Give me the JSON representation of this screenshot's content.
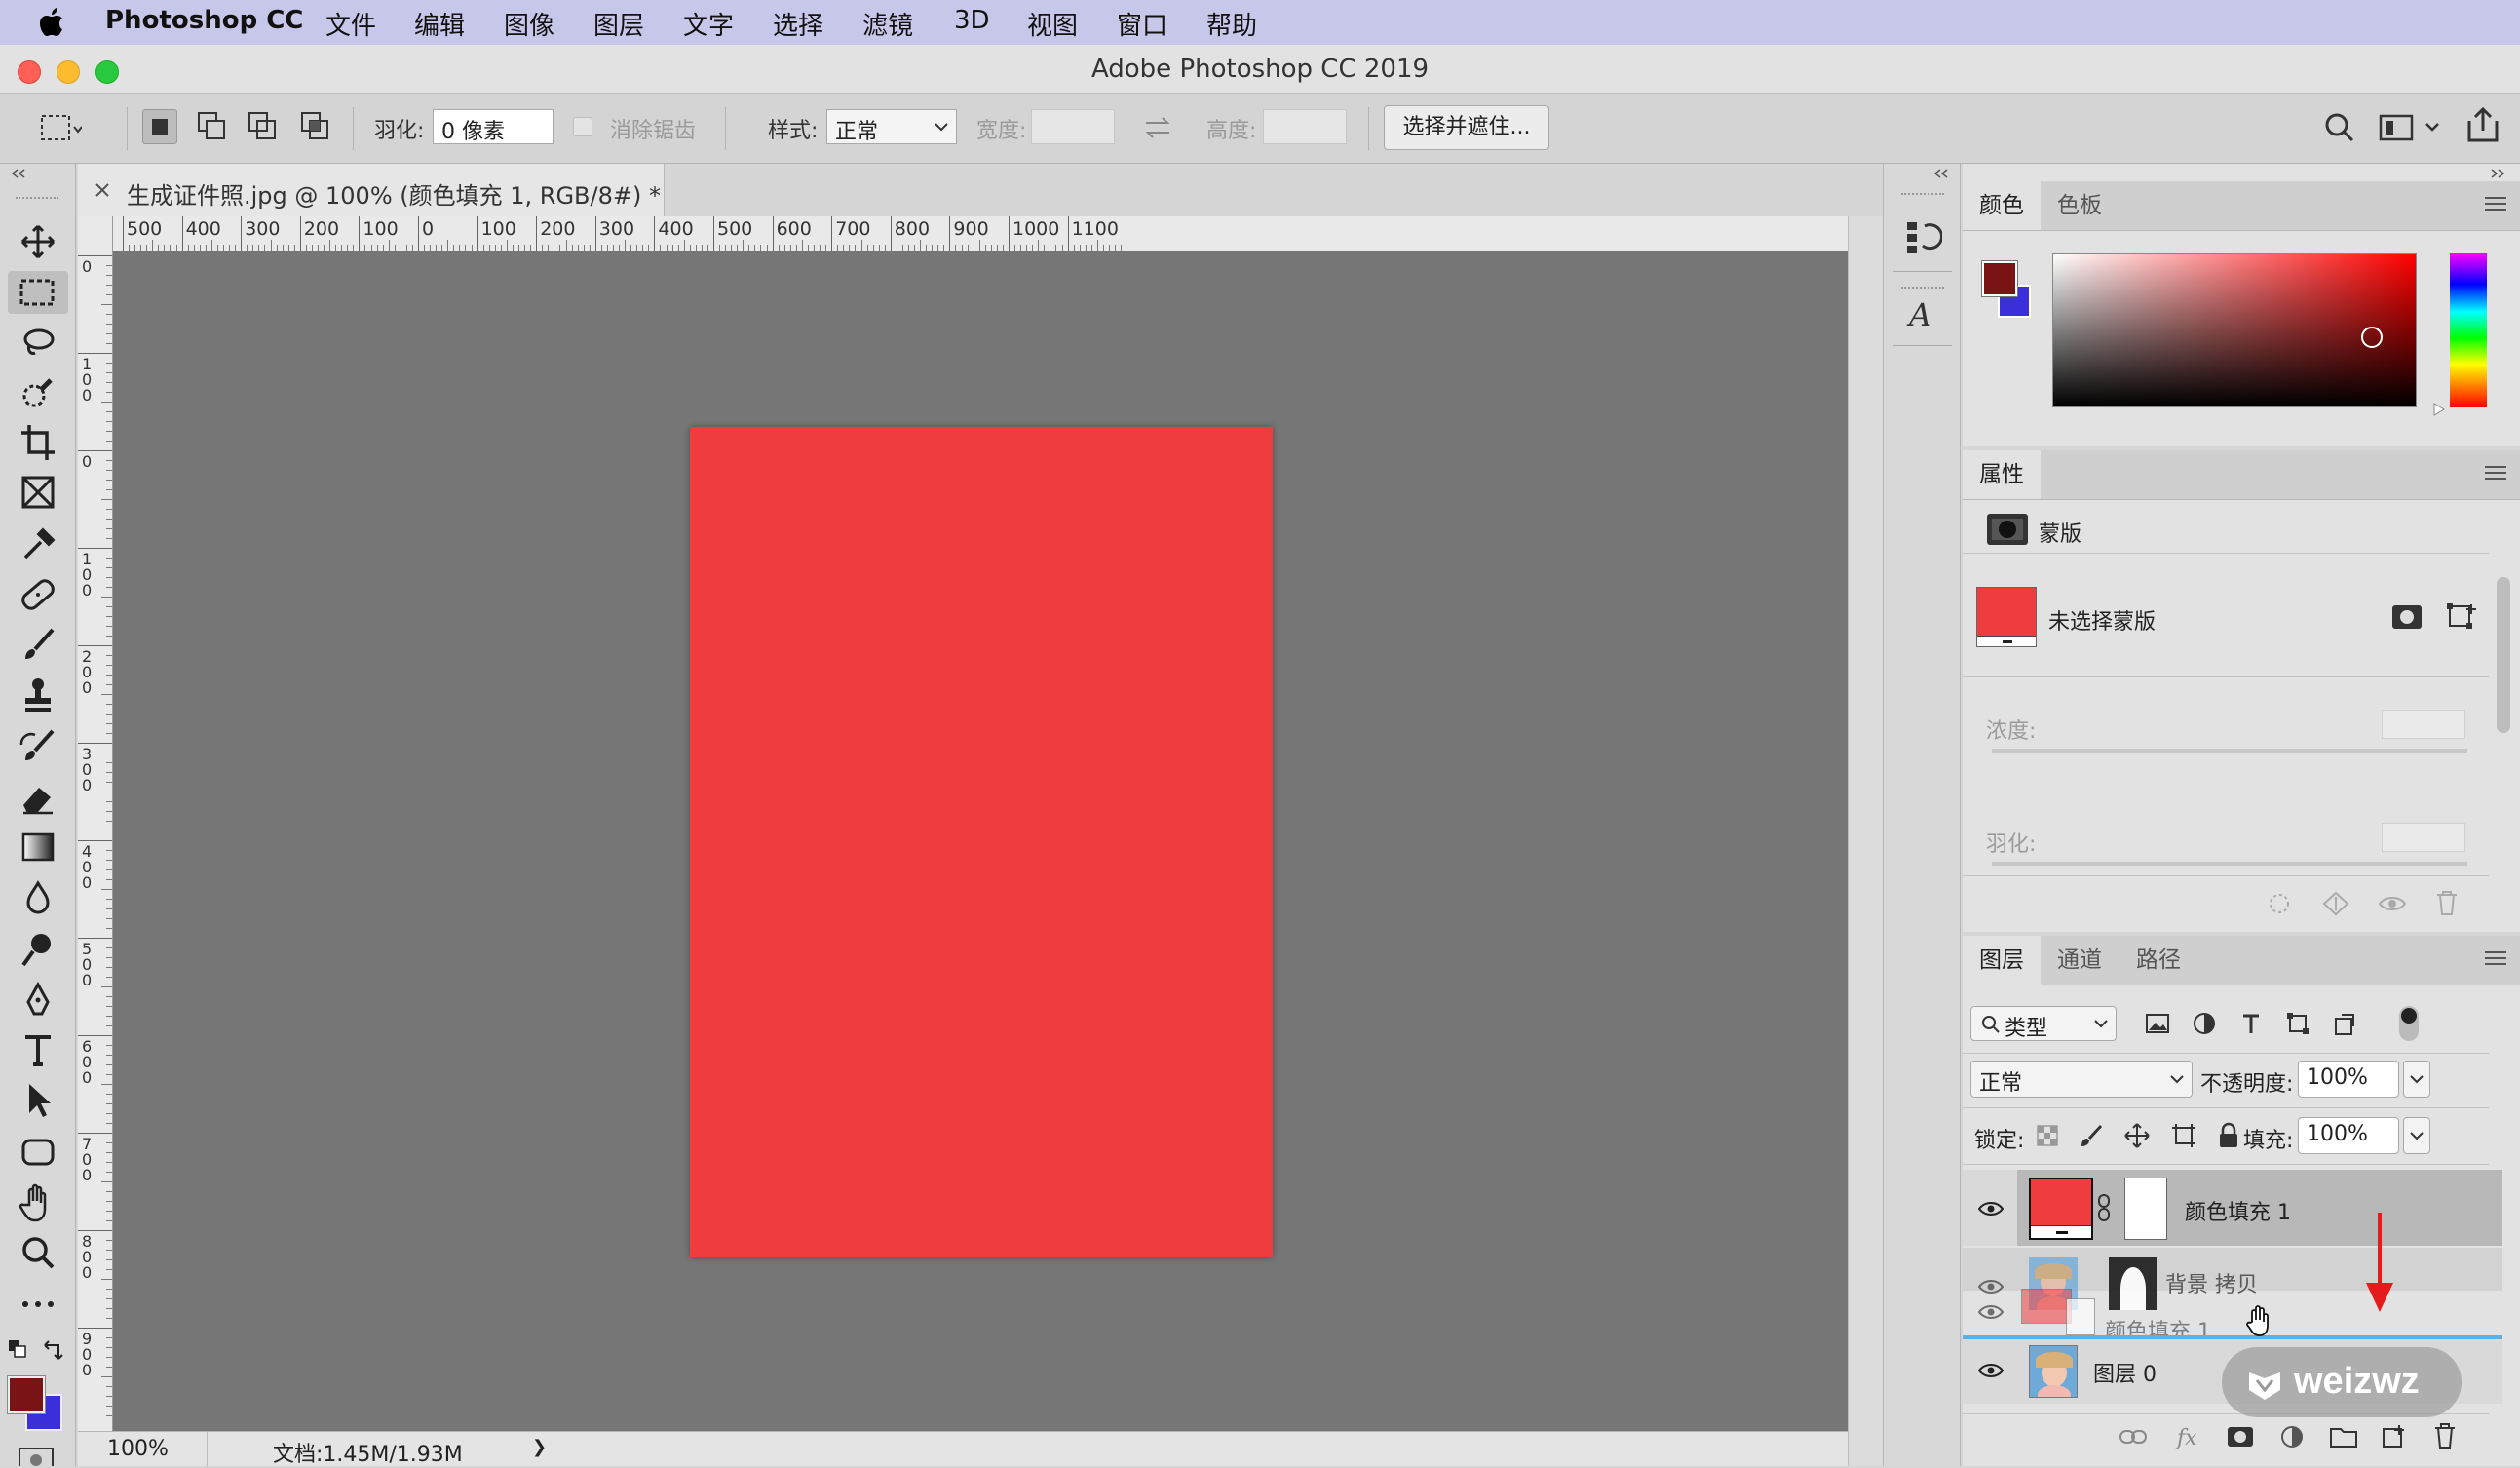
{
  "menubar": {
    "app": "Photoshop CC",
    "items": [
      "文件",
      "编辑",
      "图像",
      "图层",
      "文字",
      "选择",
      "滤镜",
      "3D",
      "视图",
      "窗口",
      "帮助"
    ]
  },
  "window": {
    "title": "Adobe Photoshop CC 2019"
  },
  "options": {
    "feather_label": "羽化:",
    "feather_value": "0 像素",
    "antialias_label": "消除锯齿",
    "style_label": "样式:",
    "style_value": "正常",
    "width_label": "宽度:",
    "height_label": "高度:",
    "select_mask_button": "选择并遮住..."
  },
  "document": {
    "tab_title": "生成证件照.jpg @ 100% (颜色填充 1, RGB/8#) *",
    "ruler_top": [
      "500",
      "400",
      "300",
      "200",
      "100",
      "0",
      "100",
      "200",
      "300",
      "400",
      "500",
      "600",
      "700",
      "800",
      "900",
      "1000",
      "1100"
    ],
    "ruler_left": [
      "0",
      "1\n0\n0",
      "0",
      "1\n0\n0",
      "2\n0\n0",
      "3\n0\n0",
      "4\n0\n0",
      "5\n0\n0",
      "6\n0\n0",
      "7\n0\n0",
      "8\n0\n0",
      "9\n0\n0"
    ],
    "canvas_color": "#ef3c3e"
  },
  "status": {
    "zoom": "100%",
    "doc_info": "文档:1.45M/1.93M",
    "arrow": "❯"
  },
  "colors": {
    "foreground": "#7a1414",
    "background": "#3a2fd8",
    "tabs": [
      "颜色",
      "色板"
    ]
  },
  "properties": {
    "tab": "属性",
    "section": "蒙版",
    "no_mask": "未选择蒙版",
    "density_label": "浓度:",
    "feather_label": "羽化:"
  },
  "layers": {
    "tabs": [
      "图层",
      "通道",
      "路径"
    ],
    "filter_kind": "类型",
    "blend_mode": "正常",
    "opacity_label": "不透明度:",
    "opacity_value": "100%",
    "lock_label": "锁定:",
    "fill_label": "填充:",
    "fill_value": "100%",
    "items": [
      {
        "name": "颜色填充 1"
      },
      {
        "name": "背景 拷贝"
      },
      {
        "name": "图层 0"
      }
    ],
    "drag_ghost_label": "颜色填充 1"
  },
  "watermark": {
    "text": "weizwz"
  }
}
